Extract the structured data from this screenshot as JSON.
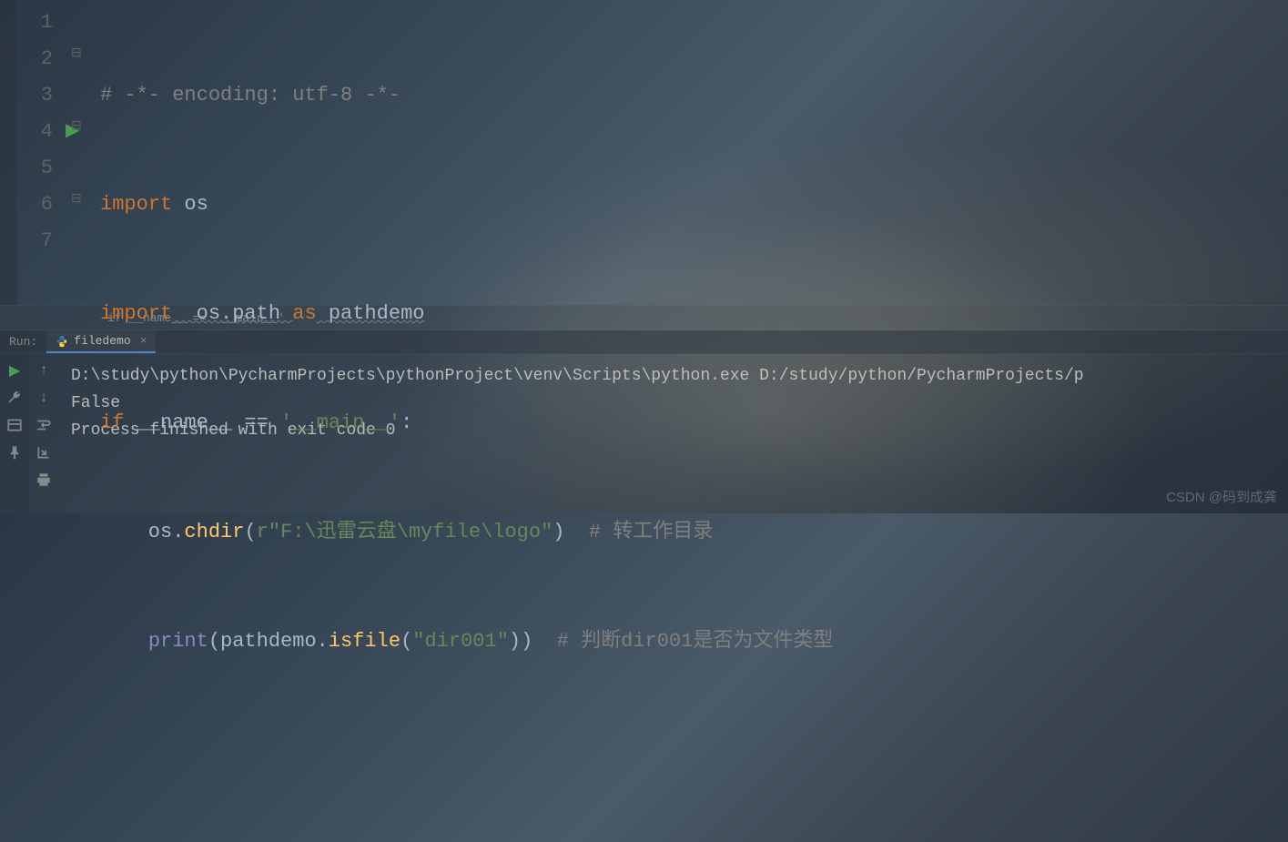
{
  "editor": {
    "line_numbers": [
      "1",
      "2",
      "3",
      "4",
      "5",
      "6",
      "7"
    ],
    "lines": {
      "l1_comment": "# -*- encoding: utf-8 -*-",
      "l2_import": "import",
      "l2_os": " os",
      "l3_import": "import",
      "l3_mid": "  os.path ",
      "l3_as": "as",
      "l3_pathdemo": " pathdemo",
      "l4_if": "if",
      "l4_name": " __name__ == ",
      "l4_main": "'__main__'",
      "l4_colon": ":",
      "l5_indent": "    os.",
      "l5_chdir": "chdir",
      "l5_paren1": "(",
      "l5_str": "r\"F:\\迅雷云盘\\myfile\\logo\"",
      "l5_paren2": ")  ",
      "l5_comment": "# 转工作目录",
      "l6_indent": "    ",
      "l6_print": "print",
      "l6_p1": "(pathdemo.",
      "l6_isfile": "isfile",
      "l6_p2": "(",
      "l6_str": "\"dir001\"",
      "l6_p3": "))  ",
      "l6_comment": "# 判断dir001是否为文件类型"
    }
  },
  "breadcrumb": "if __name__ == '__main__'",
  "run": {
    "label": "Run:",
    "tab_name": "filedemo",
    "output_line1": "D:\\study\\python\\PycharmProjects\\pythonProject\\venv\\Scripts\\python.exe D:/study/python/PycharmProjects/p",
    "output_line2": "False",
    "output_line3": "",
    "output_line4": "Process finished with exit code 0"
  },
  "watermark": "CSDN @码到成龚"
}
